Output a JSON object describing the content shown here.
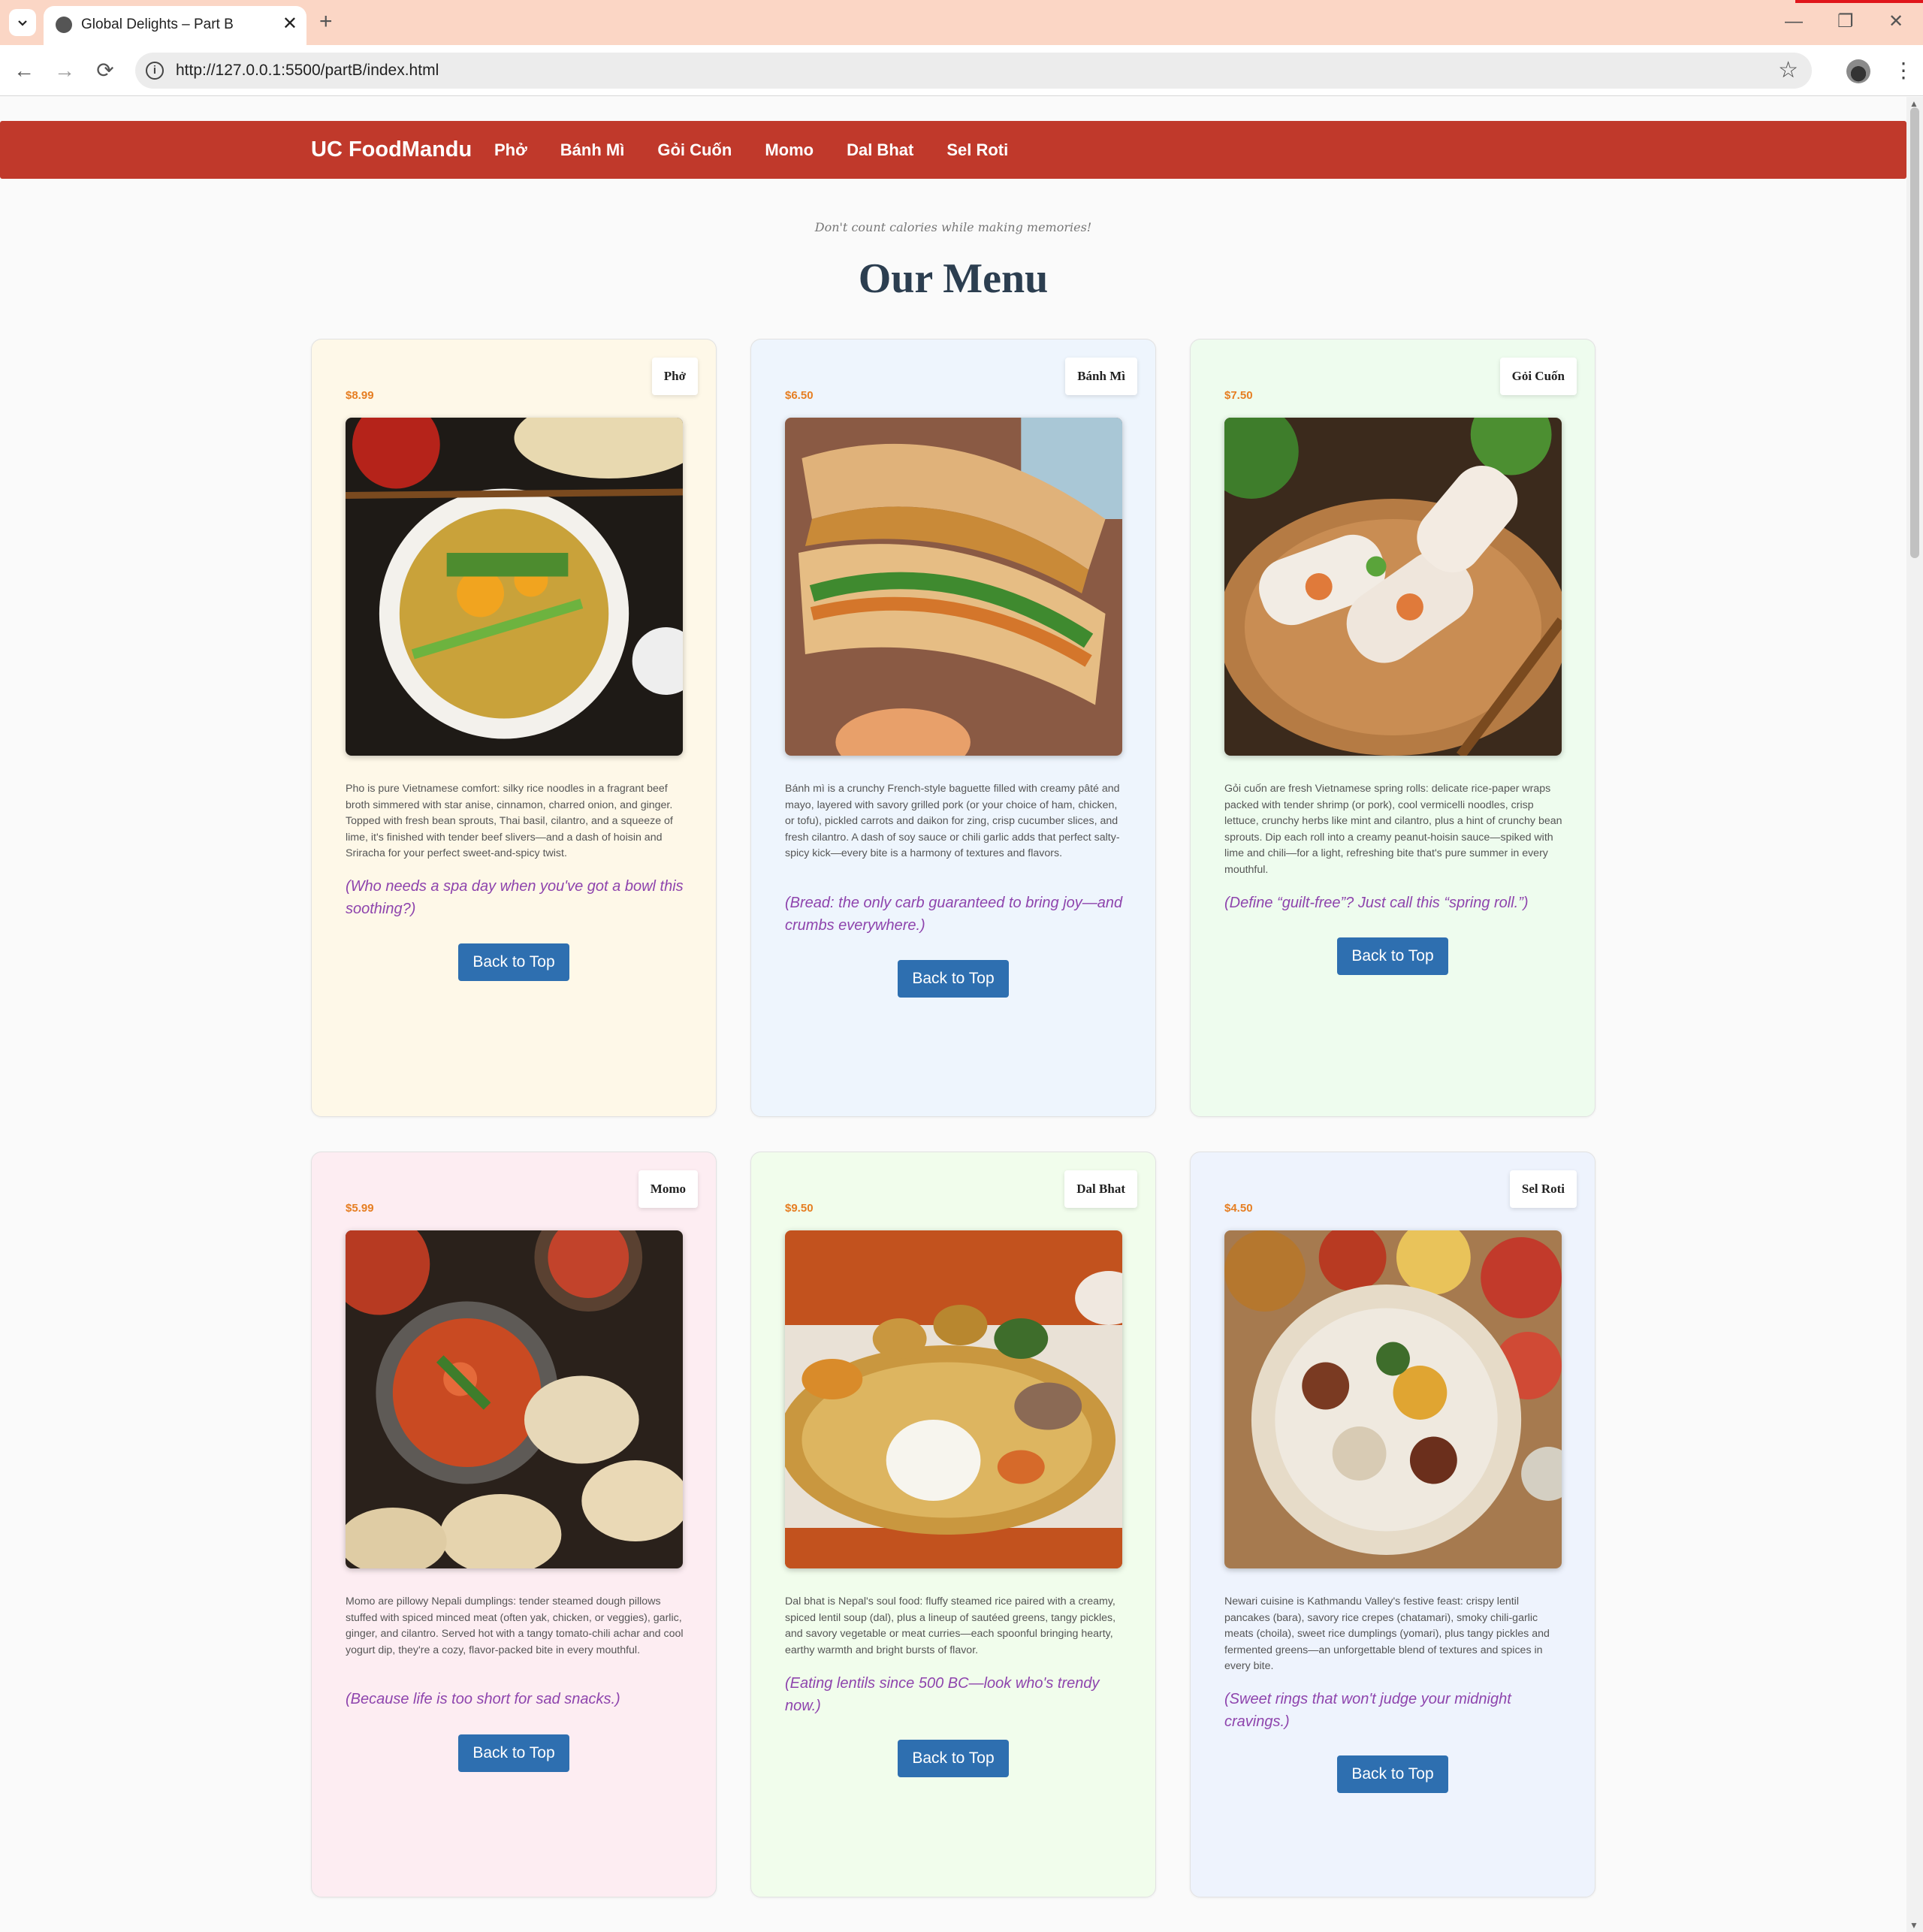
{
  "browser": {
    "tab_title": "Global Delights – Part B",
    "tab_close": "✕",
    "new_tab": "+",
    "url": "http://127.0.0.1:5500/partB/index.html",
    "controls": {
      "minimize": "—",
      "maximize": "❐",
      "close": "✕"
    }
  },
  "site": {
    "brand": "UC FoodMandu",
    "nav": [
      "Phở",
      "Bánh Mì",
      "Gỏi Cuốn",
      "Momo",
      "Dal Bhat",
      "Sel Roti"
    ],
    "tagline": "Don't count calories while making memories!",
    "title": "Our Menu"
  },
  "colors": {
    "nav_bg": "#c0392b",
    "price": "#e67e22",
    "joke": "#8e44ad",
    "button": "#2e6fb0",
    "title": "#2c3e50"
  },
  "cards": [
    {
      "name": "Phở",
      "price": "$8.99",
      "bg": "#fef8e8",
      "image": "pho-photo",
      "desc": "Pho is pure Vietnamese comfort: silky rice noodles in a fragrant beef broth simmered with star anise, cinnamon, charred onion, and ginger. Topped with fresh bean sprouts, Thai basil, cilantro, and a squeeze of lime, it's finished with tender beef slivers—and a dash of hoisin and Sriracha for your perfect sweet-and-spicy twist.",
      "joke": "(Who needs a spa day when you've got a bowl this soothing?)",
      "button": "Back to Top"
    },
    {
      "name": "Bánh Mì",
      "price": "$6.50",
      "bg": "#eef5fd",
      "image": "banh-mi-photo",
      "desc": "Bánh mì is a crunchy French-style baguette filled with creamy pâté and mayo, layered with savory grilled pork (or your choice of ham, chicken, or tofu), pickled carrots and daikon for zing, crisp cucumber slices, and fresh cilantro. A dash of soy sauce or chili garlic adds that perfect salty-spicy kick—every bite is a harmony of textures and flavors.",
      "joke": "(Bread: the only carb guaranteed to bring joy—and crumbs everywhere.)",
      "button": "Back to Top"
    },
    {
      "name": "Gỏi Cuốn",
      "price": "$7.50",
      "bg": "#eefcee",
      "image": "goi-cuon-photo",
      "desc": "Gỏi cuốn are fresh Vietnamese spring rolls: delicate rice-paper wraps packed with tender shrimp (or pork), cool vermicelli noodles, crisp lettuce, crunchy herbs like mint and cilantro, plus a hint of crunchy bean sprouts. Dip each roll into a creamy peanut-hoisin sauce—spiked with lime and chili—for a light, refreshing bite that's pure summer in every mouthful.",
      "joke": "(Define “guilt-free”? Just call this “spring roll.”)",
      "button": "Back to Top"
    },
    {
      "name": "Momo",
      "price": "$5.99",
      "bg": "#fdedf2",
      "image": "momo-photo",
      "desc": "Momo are pillowy Nepali dumplings: tender steamed dough pillows stuffed with spiced minced meat (often yak, chicken, or veggies), garlic, ginger, and cilantro. Served hot with a tangy tomato-chili achar and cool yogurt dip, they're a cozy, flavor-packed bite in every mouthful.",
      "joke": "(Because life is too short for sad snacks.)",
      "button": "Back to Top"
    },
    {
      "name": "Dal Bhat",
      "price": "$9.50",
      "bg": "#f1fdec",
      "image": "dal-bhat-photo",
      "desc": "Dal bhat is Nepal's soul food: fluffy steamed rice paired with a creamy, spiced lentil soup (dal), plus a lineup of sautéed greens, tangy pickles, and savory vegetable or meat curries—each spoonful bringing hearty, earthy warmth and bright bursts of flavor.",
      "joke": "(Eating lentils since 500 BC—look who's trendy now.)",
      "button": "Back to Top"
    },
    {
      "name": "Sel Roti",
      "price": "$4.50",
      "bg": "#eef3fd",
      "image": "sel-roti-photo",
      "desc": "Newari cuisine is Kathmandu Valley's festive feast: crispy lentil pancakes (bara), savory rice crepes (chatamari), smoky chili-garlic meats (choila), sweet rice dumplings (yomari), plus tangy pickles and fermented greens—an unforgettable blend of textures and spices in every bite.",
      "joke": "(Sweet rings that won't judge your midnight cravings.)",
      "button": "Back to Top"
    }
  ]
}
